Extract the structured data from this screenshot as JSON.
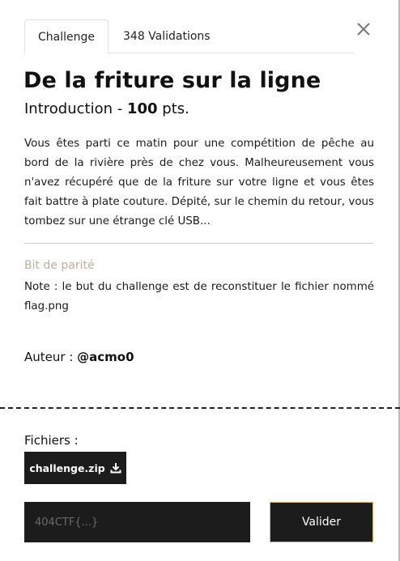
{
  "tabs": [
    {
      "label": "Challenge",
      "active": true
    },
    {
      "label": "348 Validations",
      "active": false
    }
  ],
  "challenge": {
    "title": "De la friture sur la ligne",
    "category": "Introduction",
    "separator": " - ",
    "points": "100",
    "points_suffix": " pts.",
    "description": "Vous êtes parti ce matin pour une compétition de pêche au bord de la rivière près de chez vous. Malheureusement vous n'avez récupéré que de la friture sur votre ligne et vous êtes fait battre à plate couture. Dépité, sur le chemin du retour, vous tombez sur une étrange clé USB...",
    "hint_title": "Bit de parité",
    "note": "Note : le but du challenge est de reconstituer le fichier nommé flag.png",
    "author_label": "Auteur : ",
    "author": "@acmo0"
  },
  "files": {
    "label": "Fichiers :",
    "items": [
      {
        "name": "challenge.zip",
        "icon": "download-icon"
      }
    ]
  },
  "form": {
    "placeholder": "404CTF{...}",
    "value": "",
    "submit_label": "Valider"
  },
  "colors": {
    "dark": "#1c1c1c",
    "accent_border": "#d9b25c",
    "hint": "#bfae9a"
  }
}
